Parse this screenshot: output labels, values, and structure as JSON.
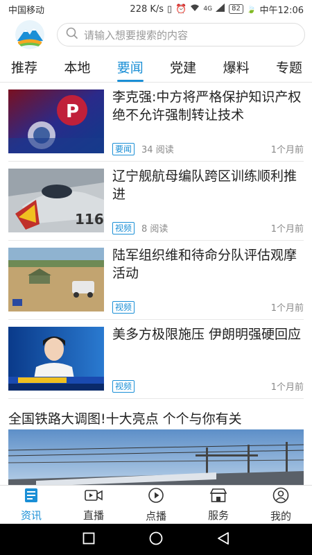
{
  "status_bar": {
    "carrier": "中国移动",
    "speed": "228 K/s",
    "signal": "4G",
    "battery": "82",
    "time": "中午12:06"
  },
  "search": {
    "placeholder": "请输入想要搜索的内容"
  },
  "tabs": [
    {
      "label": "推荐",
      "active": false
    },
    {
      "label": "本地",
      "active": false
    },
    {
      "label": "要闻",
      "active": true
    },
    {
      "label": "党建",
      "active": false
    },
    {
      "label": "爆料",
      "active": false
    },
    {
      "label": "专题",
      "active": false
    }
  ],
  "articles": [
    {
      "title": "李克强:中方将严格保护知识产权 绝不允许强制转让技术",
      "tag": "要闻",
      "reads": "34 阅读",
      "time": "1个月前",
      "thumb": "ip-graphic"
    },
    {
      "title": "辽宁舰航母编队跨区训练顺利推进",
      "tag": "视频",
      "reads": "8 阅读",
      "time": "1个月前",
      "thumb": "fighter-jet"
    },
    {
      "title": "陆军组织维和待命分队评估观摩活动",
      "tag": "视频",
      "reads": "",
      "time": "1个月前",
      "thumb": "army-field"
    },
    {
      "title": "美多方极限施压 伊朗明强硬回应",
      "tag": "视频",
      "reads": "",
      "time": "1个月前",
      "thumb": "news-anchor"
    }
  ],
  "featured": {
    "title": "全国铁路大调图!十大亮点 个个与你有关"
  },
  "bottom_nav": [
    {
      "label": "资讯",
      "icon": "news-icon",
      "active": true
    },
    {
      "label": "直播",
      "icon": "video-camera-icon",
      "active": false
    },
    {
      "label": "点播",
      "icon": "play-icon",
      "active": false
    },
    {
      "label": "服务",
      "icon": "store-icon",
      "active": false
    },
    {
      "label": "我的",
      "icon": "user-icon",
      "active": false
    }
  ],
  "colors": {
    "accent": "#1a8fd6"
  }
}
